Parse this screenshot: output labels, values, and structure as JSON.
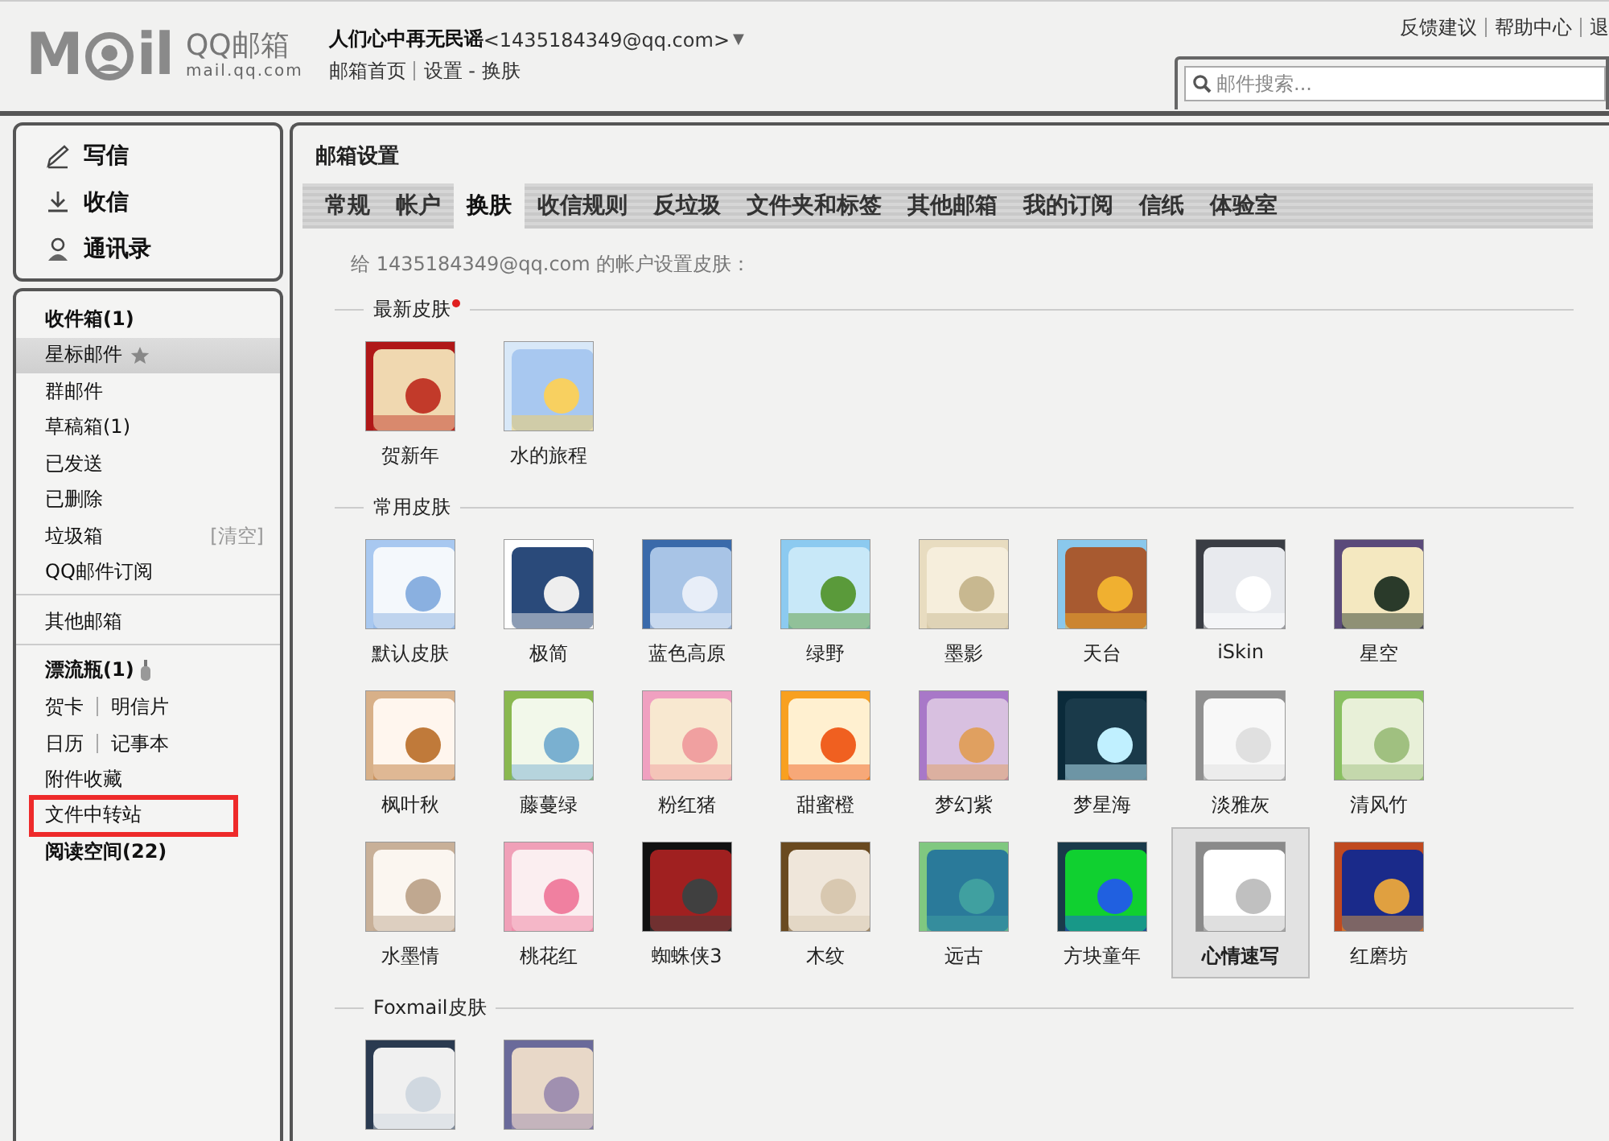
{
  "header": {
    "logo": {
      "left": "M",
      "right": "il",
      "name": "QQ邮箱",
      "domain": "mail.qq.com"
    },
    "user": {
      "name": "人们心中再无民谣",
      "email": "<1435184349@qq.com>",
      "caret": "▼"
    },
    "nav": [
      "邮箱首页",
      "设置 - 换肤"
    ],
    "top_links": [
      "反馈建议",
      "帮助中心",
      "退"
    ],
    "search": {
      "placeholder": "邮件搜索..."
    }
  },
  "sidebar": {
    "actions": [
      {
        "kind": "compose",
        "label": "写信"
      },
      {
        "kind": "receive",
        "label": "收信"
      },
      {
        "kind": "contacts",
        "label": "通讯录"
      }
    ],
    "groups": [
      [
        {
          "kind": "link",
          "label": "收件箱(1)",
          "bold": true,
          "selected": false,
          "annotated": false
        },
        {
          "kind": "star",
          "label": "星标邮件",
          "bold": false,
          "selected": true,
          "annotated": false
        },
        {
          "kind": "link",
          "label": "群邮件",
          "bold": false,
          "selected": false,
          "annotated": false
        },
        {
          "kind": "link",
          "label": "草稿箱(1)",
          "bold": false,
          "selected": false,
          "annotated": false
        },
        {
          "kind": "link",
          "label": "已发送",
          "bold": false,
          "selected": false,
          "annotated": false
        },
        {
          "kind": "link",
          "label": "已删除",
          "bold": false,
          "selected": false,
          "annotated": false
        },
        {
          "kind": "action",
          "label": "垃圾箱",
          "action": "[清空]",
          "bold": false,
          "selected": false,
          "annotated": false
        },
        {
          "kind": "link",
          "label": "QQ邮件订阅",
          "bold": false,
          "selected": false,
          "annotated": false
        }
      ],
      [
        {
          "kind": "link",
          "label": "其他邮箱",
          "bold": false,
          "selected": false,
          "annotated": false
        }
      ],
      [
        {
          "kind": "bottle",
          "label": "漂流瓶(1)",
          "bold": true,
          "selected": false,
          "annotated": false
        },
        {
          "kind": "pair",
          "labels": [
            "贺卡",
            "明信片"
          ]
        },
        {
          "kind": "pair",
          "labels": [
            "日历",
            "记事本"
          ]
        },
        {
          "kind": "link",
          "label": "附件收藏",
          "bold": false,
          "selected": false,
          "annotated": false
        },
        {
          "kind": "link",
          "label": "文件中转站",
          "bold": false,
          "selected": false,
          "annotated": true
        },
        {
          "kind": "link",
          "label": "阅读空间(22)",
          "bold": true,
          "selected": false,
          "annotated": false
        }
      ]
    ]
  },
  "main": {
    "title": "邮箱设置",
    "tabs": [
      {
        "label": "常规",
        "selected": false
      },
      {
        "label": "帐户",
        "selected": false
      },
      {
        "label": "换肤",
        "selected": true
      },
      {
        "label": "收信规则",
        "selected": false
      },
      {
        "label": "反垃圾",
        "selected": false
      },
      {
        "label": "文件夹和标签",
        "selected": false
      },
      {
        "label": "其他邮箱",
        "selected": false
      },
      {
        "label": "我的订阅",
        "selected": false
      },
      {
        "label": "信纸",
        "selected": false
      },
      {
        "label": "体验室",
        "selected": false
      }
    ],
    "intro": "给 1435184349@qq.com 的帐户设置皮肤：",
    "sections": [
      {
        "title": "最新皮肤",
        "new": true,
        "skins": [
          {
            "label": "贺新年",
            "selected": false
          },
          {
            "label": "水的旅程",
            "selected": false
          }
        ]
      },
      {
        "title": "常用皮肤",
        "skins": [
          {
            "label": "默认皮肤",
            "selected": false
          },
          {
            "label": "极简",
            "selected": false
          },
          {
            "label": "蓝色高原",
            "selected": false
          },
          {
            "label": "绿野",
            "selected": false
          },
          {
            "label": "墨影",
            "selected": false
          },
          {
            "label": "天台",
            "selected": false
          },
          {
            "label": "iSkin",
            "selected": false
          },
          {
            "label": "星空",
            "selected": false
          },
          {
            "label": "枫叶秋",
            "selected": false
          },
          {
            "label": "藤蔓绿",
            "selected": false
          },
          {
            "label": "粉红猪",
            "selected": false
          },
          {
            "label": "甜蜜橙",
            "selected": false
          },
          {
            "label": "梦幻紫",
            "selected": false
          },
          {
            "label": "梦星海",
            "selected": false
          },
          {
            "label": "淡雅灰",
            "selected": false
          },
          {
            "label": "清风竹",
            "selected": false
          },
          {
            "label": "水墨情",
            "selected": false
          },
          {
            "label": "桃花红",
            "selected": false
          },
          {
            "label": "蜘蛛侠3",
            "selected": false
          },
          {
            "label": "木纹",
            "selected": false
          },
          {
            "label": "远古",
            "selected": false
          },
          {
            "label": "方块童年",
            "selected": false
          },
          {
            "label": "心情速写",
            "selected": true
          },
          {
            "label": "红磨坊",
            "selected": false
          }
        ]
      },
      {
        "title": "Foxmail皮肤"
      }
    ]
  }
}
